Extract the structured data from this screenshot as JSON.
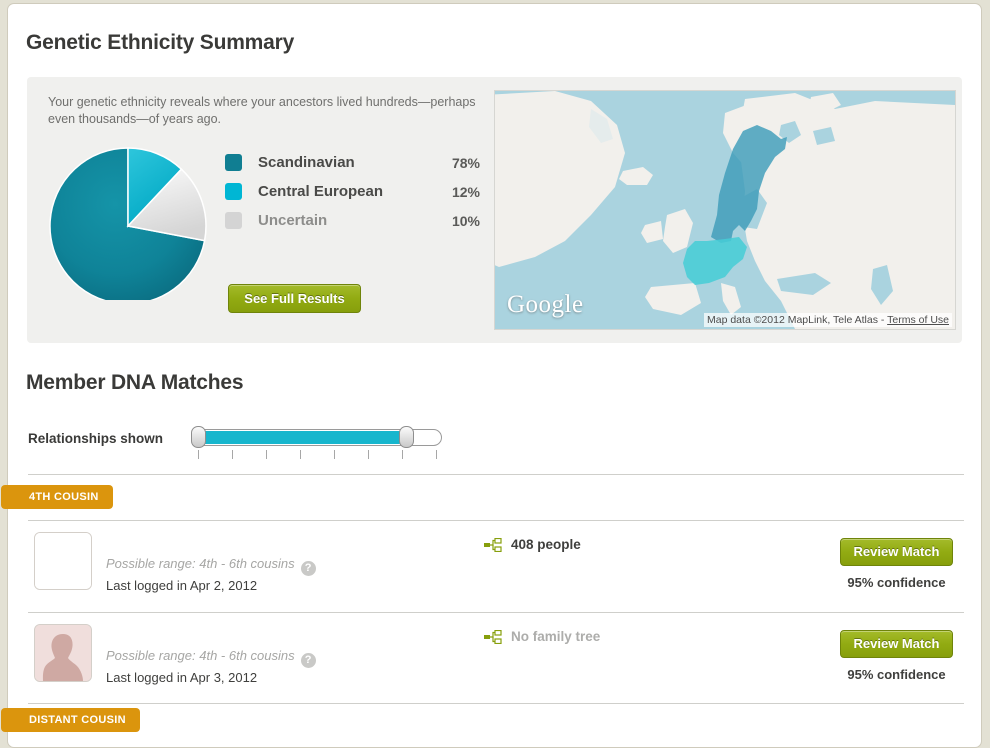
{
  "page": {
    "title": "Genetic Ethnicity Summary",
    "section_title": "Member DNA Matches"
  },
  "ethnicity": {
    "intro": "Your genetic ethnicity reveals where your ancestors lived hundreds—perhaps even thousands—of years ago.",
    "see_full_results_label": "See Full Results",
    "legend": [
      {
        "label": "Scandinavian",
        "percent": "78%",
        "color": "#107e92"
      },
      {
        "label": "Central European",
        "percent": "12%",
        "color": "#00b6d4"
      },
      {
        "label": "Uncertain",
        "percent": "10%",
        "color": "#d4d4d4"
      }
    ]
  },
  "chart_data": {
    "type": "pie",
    "title": "Genetic Ethnicity Summary",
    "categories": [
      "Scandinavian",
      "Central European",
      "Uncertain"
    ],
    "values": [
      78,
      12,
      10
    ],
    "unit": "percent",
    "colors": [
      "#107e92",
      "#00b6d4",
      "#d4d4d4"
    ],
    "start_angle_deg": 0,
    "direction": "clockwise",
    "legend_position": "right"
  },
  "map": {
    "logo": "Google",
    "attribution_prefix": "Map data ©2012 MapLink, Tele Atlas - ",
    "terms_label": "Terms of Use",
    "ocean_color": "#aad3df",
    "land_color": "#f2f0ec",
    "highlight_scandinavia_color": "#3e9cb9",
    "highlight_central_color": "#45cdd6"
  },
  "slider": {
    "label": "Relationships shown",
    "tick_count": 8,
    "min_handle_position_pct": 0,
    "max_handle_position_pct": 84,
    "fill_color": "#17b6cd"
  },
  "groups": [
    {
      "badge": "4TH COUSIN"
    },
    {
      "badge": "DISTANT COUSIN"
    }
  ],
  "matches": [
    {
      "avatar_type": "blank",
      "range": "Possible range: 4th - 6th cousins",
      "help": "?",
      "last_login": "Last logged in Apr 2, 2012",
      "tree_text": "408 people",
      "tree_empty": false,
      "review_label": "Review Match",
      "confidence": "95% confidence"
    },
    {
      "avatar_type": "silhouette",
      "range": "Possible range: 4th - 6th cousins",
      "help": "?",
      "last_login": "Last logged in Apr 3, 2012",
      "tree_text": "No family tree",
      "tree_empty": true,
      "review_label": "Review Match",
      "confidence": "95% confidence"
    }
  ]
}
